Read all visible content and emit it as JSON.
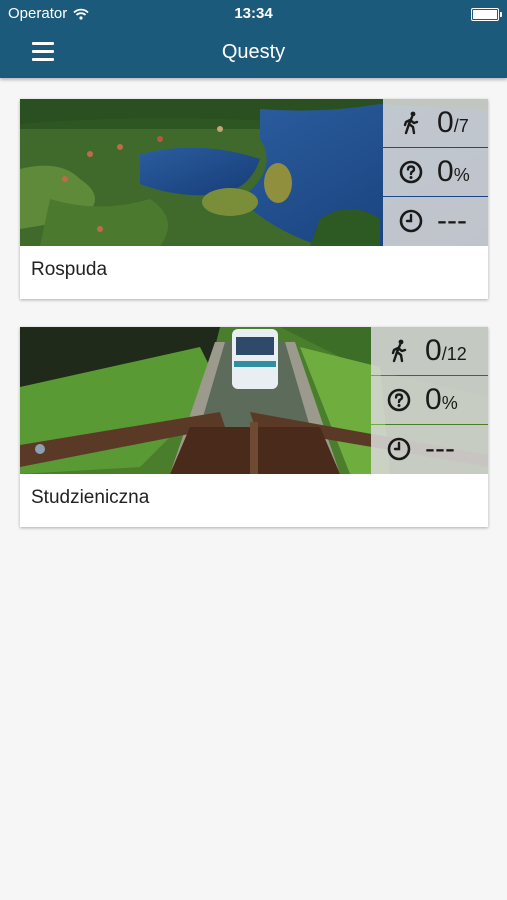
{
  "status_bar": {
    "carrier": "Operator",
    "time": "13:34"
  },
  "nav": {
    "title": "Questy"
  },
  "quests": [
    {
      "name": "Rospuda",
      "progress_value": "0",
      "progress_total": "/7",
      "percent_value": "0",
      "percent_unit": "%",
      "time": "---"
    },
    {
      "name": "Studzieniczna",
      "progress_value": "0",
      "progress_total": "/12",
      "percent_value": "0",
      "percent_unit": "%",
      "time": "---"
    }
  ],
  "icons": {
    "menu": "hamburger-menu-icon",
    "wifi": "wifi-icon",
    "battery": "battery-icon",
    "progress": "walking-person-icon",
    "percent": "question-circle-icon",
    "time": "clock-icon"
  },
  "colors": {
    "nav_bar": "#1c5a7c",
    "background": "#f6f6f6",
    "stat_panel": "#d7d7d7"
  }
}
